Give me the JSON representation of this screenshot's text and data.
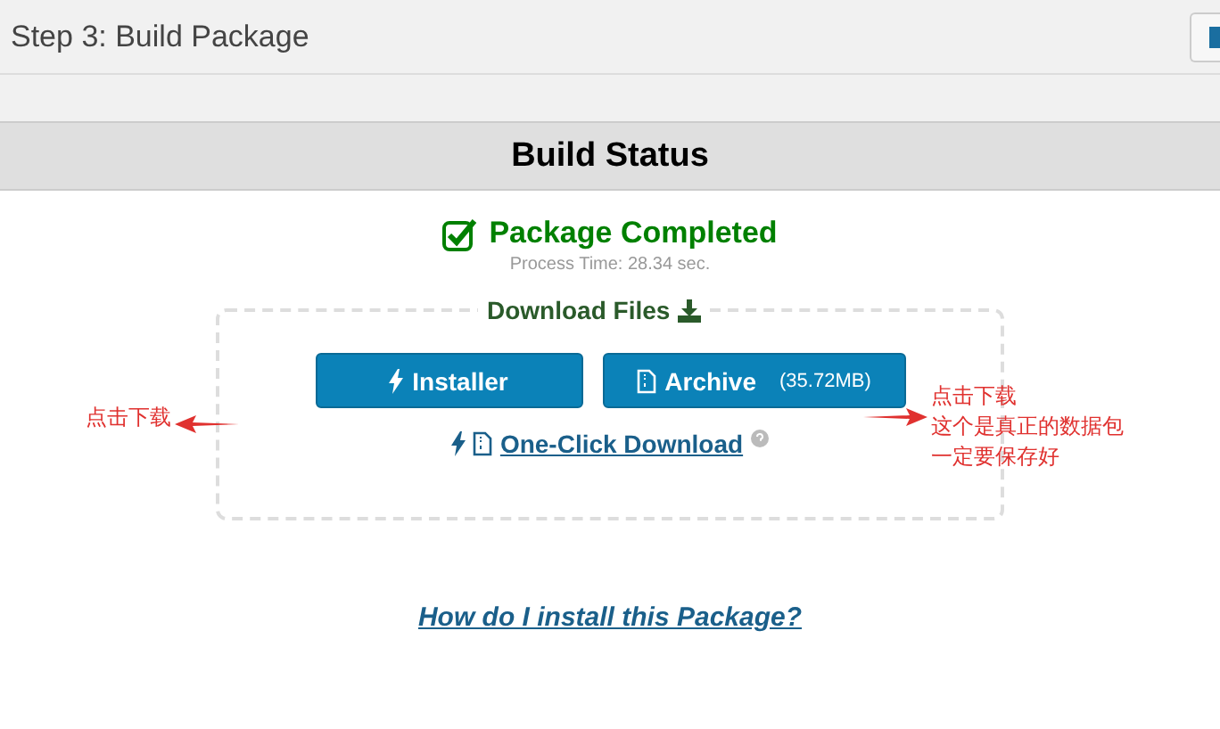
{
  "header": {
    "title": "Step 3: Build Package"
  },
  "section": {
    "title": "Build Status"
  },
  "status": {
    "title": "Package Completed",
    "process_time": "Process Time: 28.34 sec."
  },
  "downloads": {
    "legend": "Download Files",
    "buttons": [
      {
        "kind": "installer",
        "label": "Installer"
      },
      {
        "kind": "archive",
        "label": "Archive",
        "size": "(35.72MB)"
      }
    ],
    "one_click": "One-Click Download"
  },
  "help_link": "How do I install this Package?",
  "annotations": [
    {
      "lines": [
        "点击下载"
      ]
    },
    {
      "lines": [
        "点击下载",
        "这个是真正的数据包",
        "一定要保存好"
      ]
    }
  ]
}
